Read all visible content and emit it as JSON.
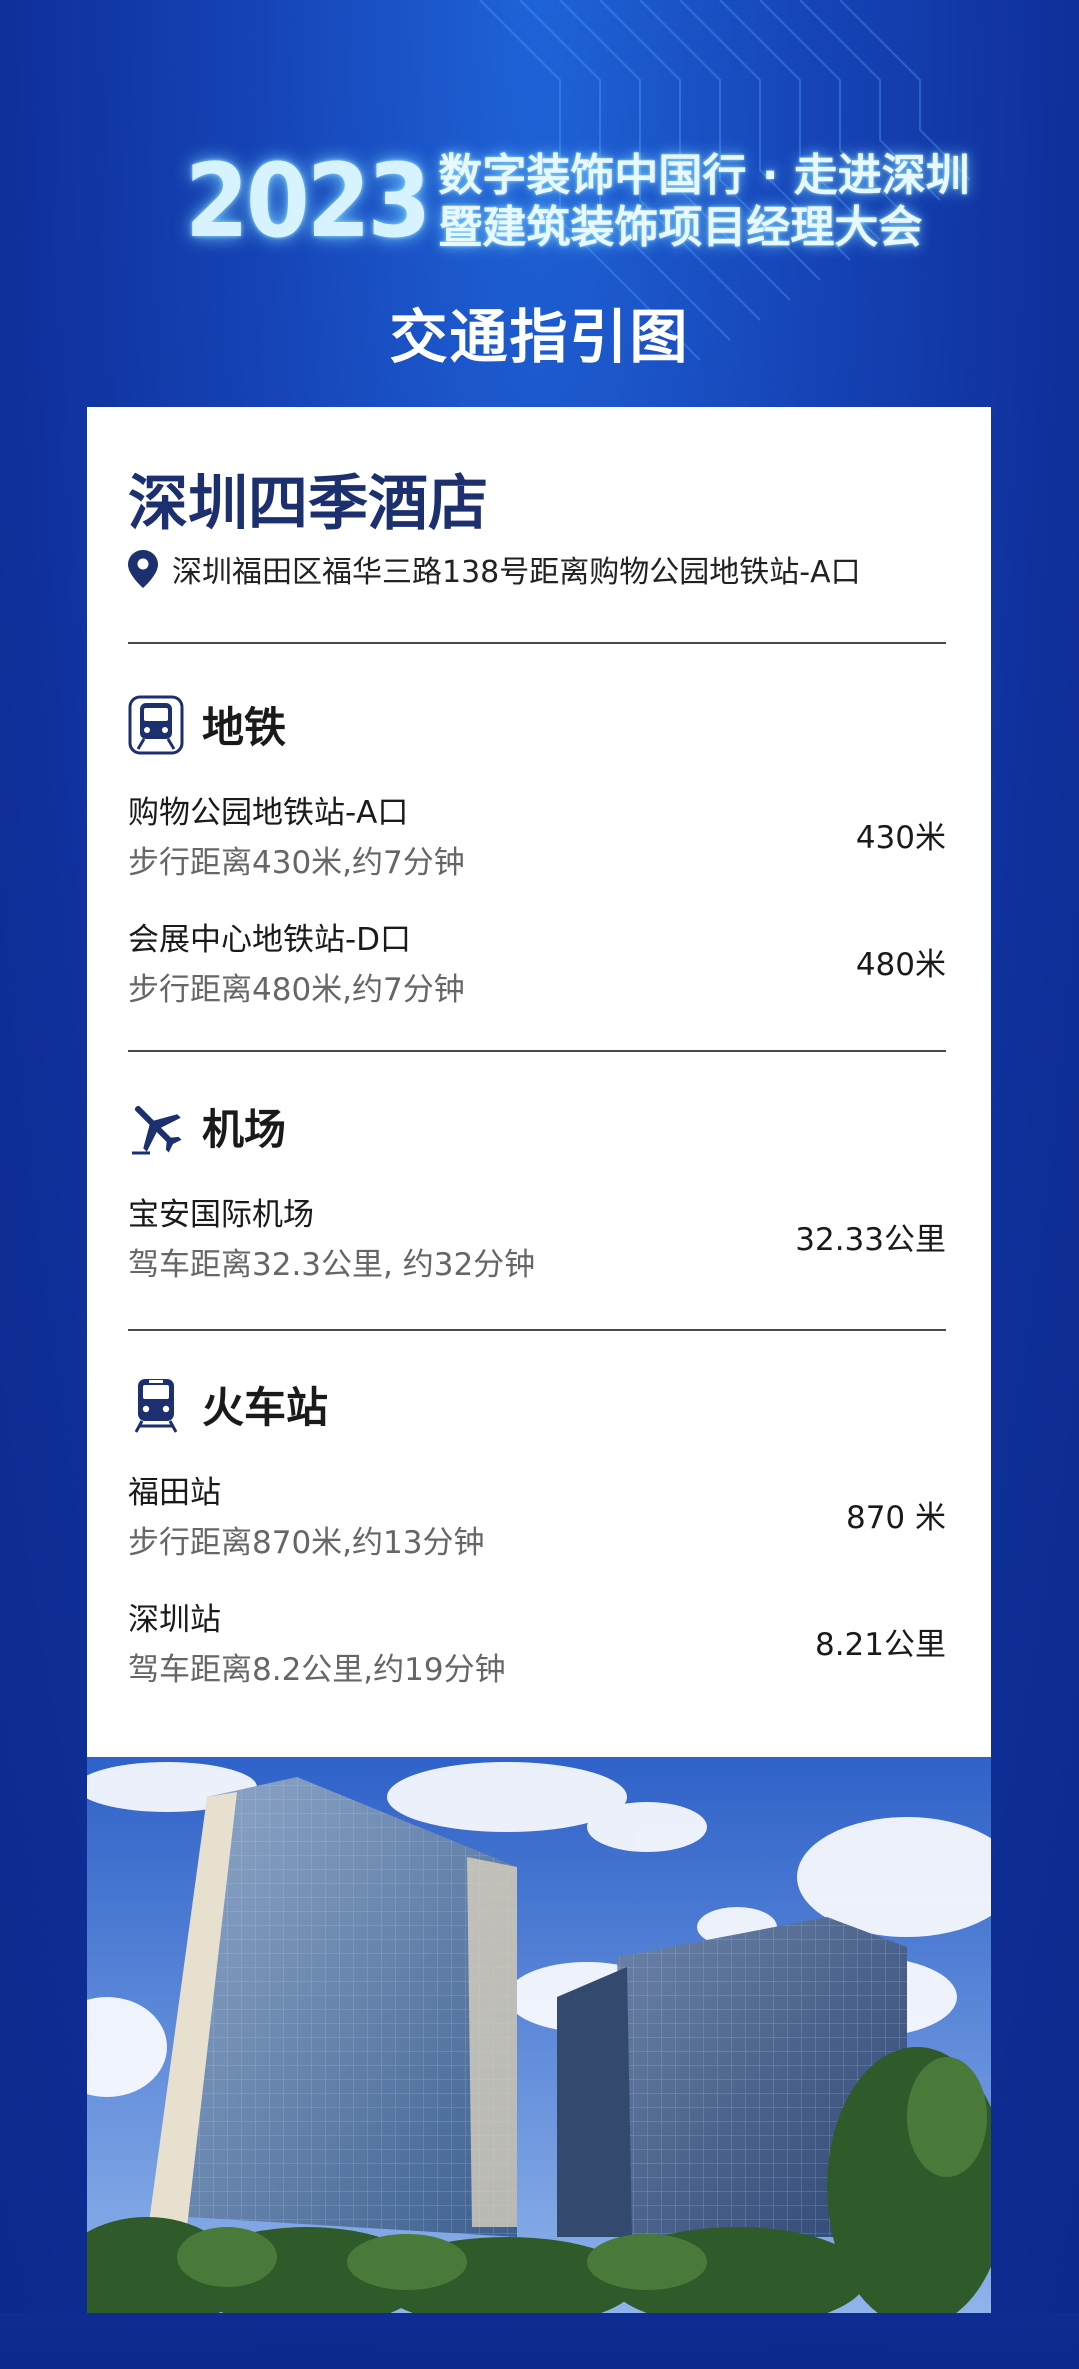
{
  "header": {
    "year": "2023",
    "title_line1": "数字装饰中国行 · 走进深圳",
    "title_line2": "暨建筑装饰项目经理大会",
    "subtitle": "交通指引图"
  },
  "hotel": {
    "name": "深圳四季酒店",
    "address": "深圳福田区福华三路138号距离购物公园地铁站-A口"
  },
  "sections": [
    {
      "icon": "subway-icon",
      "title": "地铁",
      "entries": [
        {
          "name": "购物公园地铁站-A口",
          "desc": "步行距离430米,约7分钟",
          "distance": "430米"
        },
        {
          "name": "会展中心地铁站-D口",
          "desc": "步行距离480米,约7分钟",
          "distance": "480米"
        }
      ]
    },
    {
      "icon": "airplane-icon",
      "title": "机场",
      "entries": [
        {
          "name": "宝安国际机场",
          "desc": "驾车距离32.3公里, 约32分钟",
          "distance": "32.33公里"
        }
      ]
    },
    {
      "icon": "train-icon",
      "title": "火车站",
      "entries": [
        {
          "name": "福田站",
          "desc": "步行距离870米,约13分钟",
          "distance": "870 米"
        },
        {
          "name": "深圳站",
          "desc": "驾车距离8.2公里,约19分钟",
          "distance": "8.21公里"
        }
      ]
    }
  ],
  "colors": {
    "background": "#1645b8",
    "accent_dark_blue": "#1c2f6f",
    "glow": "#78d2ff"
  }
}
